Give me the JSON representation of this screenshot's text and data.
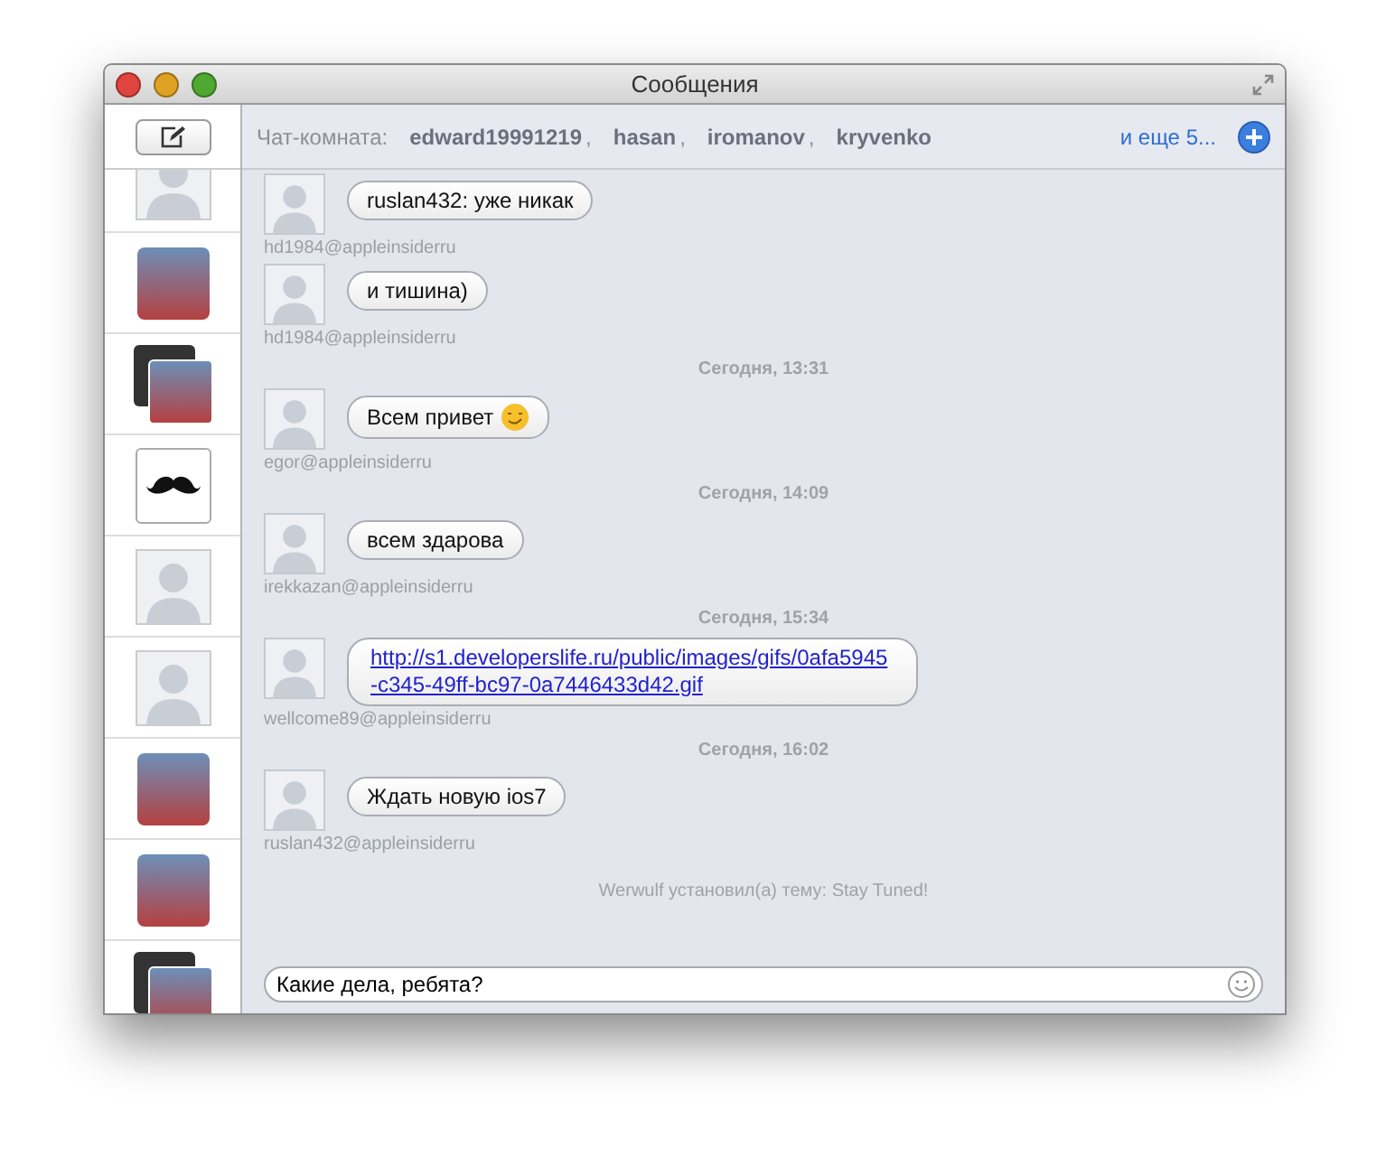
{
  "window": {
    "title": "Сообщения"
  },
  "sidebar": {
    "items": [
      {
        "kind": "placeholder"
      },
      {
        "kind": "photo"
      },
      {
        "kind": "stack"
      },
      {
        "kind": "mustache"
      },
      {
        "kind": "placeholder"
      },
      {
        "kind": "placeholder"
      },
      {
        "kind": "photo"
      },
      {
        "kind": "photo"
      },
      {
        "kind": "stack"
      }
    ]
  },
  "chat_header": {
    "label": "Чат-комната:",
    "participants": [
      "edward19991219",
      "hasan",
      "iromanov",
      "kryvenko"
    ],
    "separator": ",",
    "more": "и еще 5..."
  },
  "messages": [
    {
      "kind": "message",
      "text": "ruslan432: уже никак",
      "sender": "hd1984@appleinsiderru"
    },
    {
      "kind": "message",
      "text": "и тишина)",
      "sender": "hd1984@appleinsiderru"
    },
    {
      "kind": "time",
      "text": "Сегодня, 13:31"
    },
    {
      "kind": "message",
      "text": "Всем привет",
      "emoji": true,
      "sender": "egor@appleinsiderru"
    },
    {
      "kind": "time",
      "text": "Сегодня, 14:09"
    },
    {
      "kind": "message",
      "text": "всем здарова",
      "sender": "irekkazan@appleinsiderru"
    },
    {
      "kind": "time",
      "text": "Сегодня, 15:34"
    },
    {
      "kind": "link",
      "text": "http://s1.developerslife.ru/public/images/gifs/0afa5945-c345-49ff-bc97-0a7446433d42.gif",
      "sender": "wellcome89@appleinsiderru"
    },
    {
      "kind": "time",
      "text": "Сегодня, 16:02"
    },
    {
      "kind": "message",
      "text": "Ждать новую ios7",
      "sender": "ruslan432@appleinsiderru"
    },
    {
      "kind": "system",
      "text": "Werwulf установил(а) тему: Stay Tuned!"
    }
  ],
  "composer": {
    "value": "Какие дела, ребята?"
  }
}
